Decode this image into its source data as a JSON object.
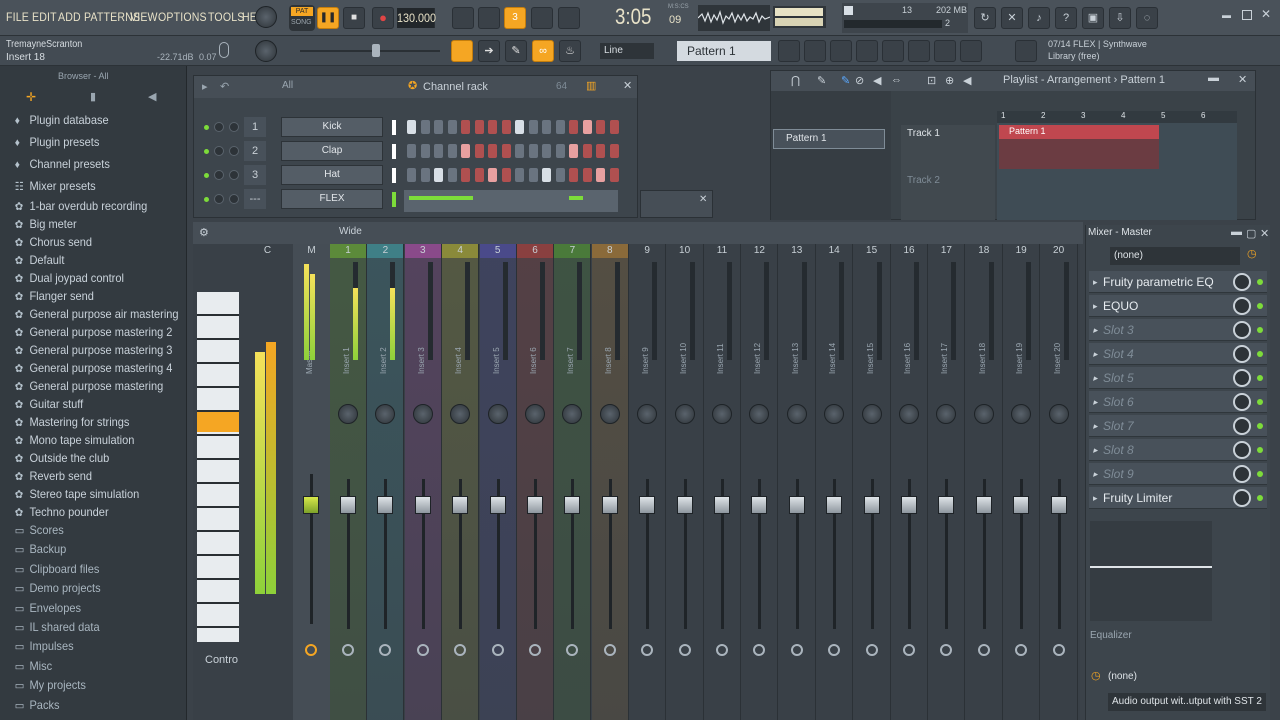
{
  "menu": [
    "FILE",
    "EDIT",
    "ADD",
    "PATTERNS",
    "VIEW",
    "OPTIONS",
    "TOOLS",
    "HELP"
  ],
  "transport": {
    "mode_pat": "PAT",
    "mode_song": "SONG",
    "tempo": "130.000",
    "time": "3:05",
    "time_sub": "09",
    "time_label": "M:S:CS"
  },
  "cpu": {
    "count": "13",
    "memory": "202 MB",
    "voices": "2"
  },
  "hint": {
    "user": "TremayneScranton",
    "target": "Insert 18",
    "db": "-22.71dB",
    "val": "0.07"
  },
  "toolbar2": {
    "snap": "Line",
    "pattern": "Pattern 1",
    "news": "07/14  FLEX | Synthwave Library (free)"
  },
  "browser": {
    "title": "Browser - All",
    "top_items": [
      {
        "label": "Plugin database",
        "icon": "plugin-database-icon"
      },
      {
        "label": "Plugin presets",
        "icon": "plugin-presets-icon"
      },
      {
        "label": "Channel presets",
        "icon": "channel-presets-icon"
      },
      {
        "label": "Mixer presets",
        "icon": "mixer-presets-icon"
      }
    ],
    "presets": [
      "1-bar overdub recording",
      "Big meter",
      "Chorus send",
      "Default",
      "Dual joypad control",
      "Flanger send",
      "General purpose air mastering",
      "General purpose mastering 2",
      "General purpose mastering 3",
      "General purpose mastering 4",
      "General purpose mastering",
      "Guitar stuff",
      "Mastering for strings",
      "Mono tape simulation",
      "Outside the club",
      "Reverb send",
      "Stereo tape simulation",
      "Techno pounder"
    ],
    "folders": [
      "Scores",
      "Backup",
      "Clipboard files",
      "Demo projects",
      "Envelopes",
      "IL shared data",
      "Impulses",
      "Misc",
      "My projects",
      "Packs"
    ]
  },
  "channel_rack": {
    "title": "Channel rack",
    "filter": "All",
    "swing": "64",
    "channels": [
      {
        "num": "1",
        "name": "Kick"
      },
      {
        "num": "2",
        "name": "Clap"
      },
      {
        "num": "3",
        "name": "Hat"
      },
      {
        "num": "---",
        "name": "FLEX"
      }
    ]
  },
  "playlist": {
    "title": "Playlist - Arrangement › Pattern 1",
    "pattern_item": "Pattern 1",
    "tracks": [
      "Track 1",
      "Track 2"
    ],
    "clip": "Pattern 1",
    "bars": [
      "1",
      "2",
      "3",
      "4",
      "5",
      "6"
    ]
  },
  "mixer": {
    "preset": "Wide",
    "master": "Master",
    "current_label": "C",
    "master_label": "M",
    "inserts": [
      "Insert 1",
      "Insert 2",
      "Insert 3",
      "Insert 4",
      "Insert 5",
      "Insert 6",
      "Insert 7",
      "Insert 8",
      "Insert 9",
      "Insert 10",
      "Insert 11",
      "Insert 12",
      "Insert 13",
      "Insert 14",
      "Insert 15",
      "Insert 16",
      "Insert 17",
      "Insert 18",
      "Insert 19",
      "Insert 20"
    ],
    "strip_colors": [
      "#5c8a3a",
      "#3f7f86",
      "#8a4a8a",
      "#8a8a3a",
      "#4a4a8a",
      "#8a4040",
      "#4a7a3a",
      "#8a6a3a"
    ],
    "contro_label": "Contro"
  },
  "mixer_master": {
    "title": "Mixer - Master",
    "input": "(none)",
    "slots": [
      {
        "label": "Fruity parametric EQ",
        "empty": false
      },
      {
        "label": "EQUO",
        "empty": false
      },
      {
        "label": "Slot 3",
        "empty": true
      },
      {
        "label": "Slot 4",
        "empty": true
      },
      {
        "label": "Slot 5",
        "empty": true
      },
      {
        "label": "Slot 6",
        "empty": true
      },
      {
        "label": "Slot 7",
        "empty": true
      },
      {
        "label": "Slot 8",
        "empty": true
      },
      {
        "label": "Slot 9",
        "empty": true
      },
      {
        "label": "Fruity Limiter",
        "empty": false
      }
    ],
    "eq_label": "Equalizer",
    "output_none": "(none)",
    "audio_output": "Audio output wit..utput with SST 2"
  }
}
